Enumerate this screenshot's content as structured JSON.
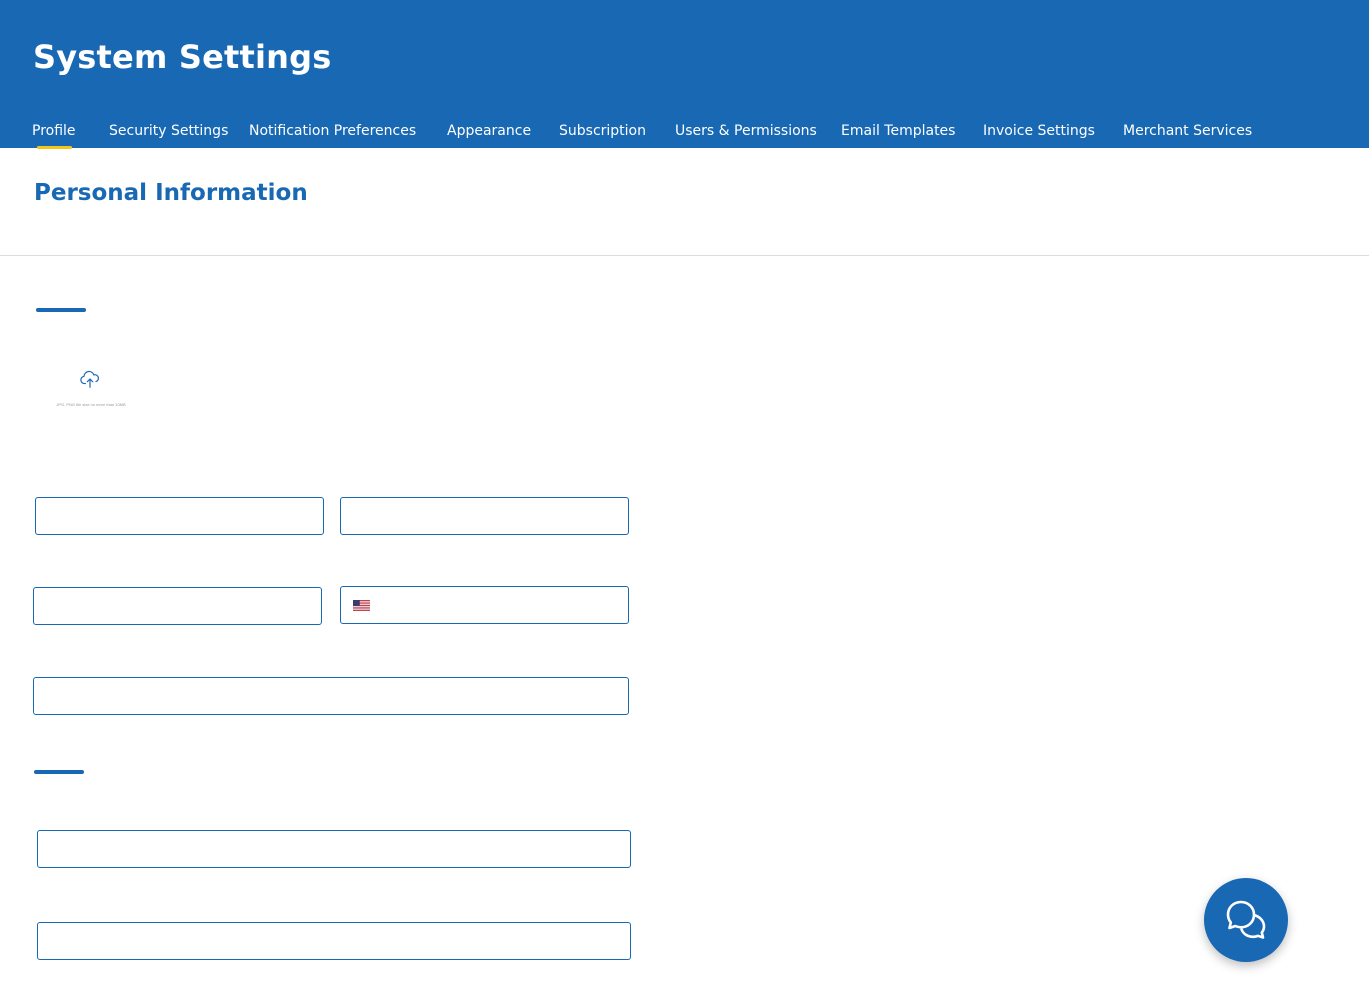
{
  "header": {
    "title": "System Settings",
    "tabs": [
      {
        "label": "Profile",
        "active": true
      },
      {
        "label": "Security Settings"
      },
      {
        "label": "Notification Preferences"
      },
      {
        "label": "Appearance"
      },
      {
        "label": "Subscription"
      },
      {
        "label": "Users & Permissions"
      },
      {
        "label": "Email Templates"
      },
      {
        "label": "Invoice Settings"
      },
      {
        "label": "Merchant Services"
      }
    ]
  },
  "main": {
    "section_title": "Personal Information",
    "upload": {
      "icon": "cloud-upload-icon",
      "hint": "JPG, PNG file size no more than 10MB"
    },
    "fields": {
      "first_name": {
        "value": "",
        "placeholder": ""
      },
      "last_name": {
        "value": "",
        "placeholder": ""
      },
      "email": {
        "value": "",
        "placeholder": ""
      },
      "phone": {
        "value": "",
        "placeholder": "",
        "country_flag": "us-flag-icon"
      },
      "address": {
        "value": "",
        "placeholder": ""
      },
      "field_6": {
        "value": "",
        "placeholder": ""
      },
      "field_7": {
        "value": "",
        "placeholder": ""
      }
    }
  },
  "chat": {
    "icon": "chat-bubbles-icon"
  },
  "colors": {
    "primary": "#1868b3",
    "tab_indicator": "#f5c518",
    "background": "#ffffff"
  }
}
